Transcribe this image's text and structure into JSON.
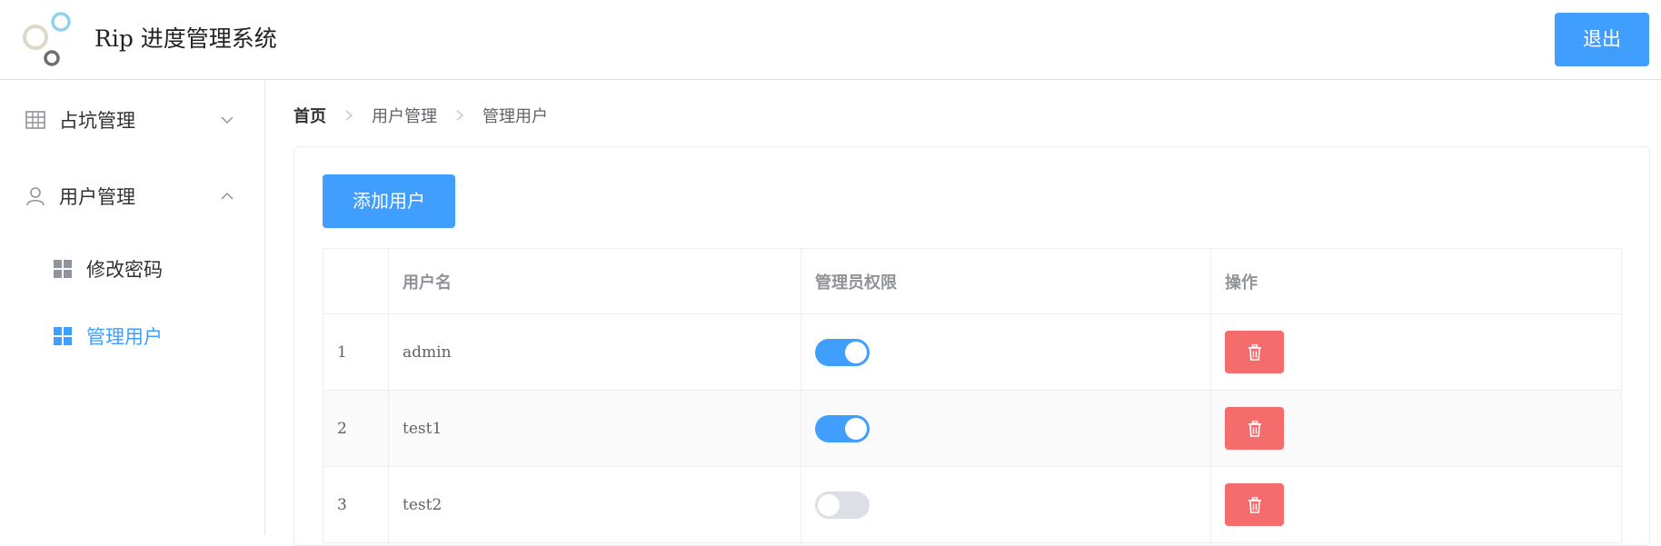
{
  "header": {
    "title": "Rip 进度管理系统",
    "logout_label": "退出"
  },
  "sidebar": {
    "groups": [
      {
        "label": "占坑管理",
        "icon": "grid-icon",
        "expanded": false
      },
      {
        "label": "用户管理",
        "icon": "user-icon",
        "expanded": true,
        "items": [
          {
            "label": "修改密码",
            "icon": "menu-grid-icon",
            "active": false
          },
          {
            "label": "管理用户",
            "icon": "menu-grid-icon",
            "active": true
          }
        ]
      }
    ]
  },
  "breadcrumb": [
    "首页",
    "用户管理",
    "管理用户"
  ],
  "main": {
    "add_button_label": "添加用户",
    "table": {
      "columns": [
        "",
        "用户名",
        "管理员权限",
        "操作"
      ],
      "rows": [
        {
          "index": "1",
          "username": "admin",
          "is_admin": true
        },
        {
          "index": "2",
          "username": "test1",
          "is_admin": true
        },
        {
          "index": "3",
          "username": "test2",
          "is_admin": false
        }
      ]
    }
  },
  "colors": {
    "primary": "#409eff",
    "danger": "#f56c6c",
    "switch_off": "#dcdfe6"
  }
}
